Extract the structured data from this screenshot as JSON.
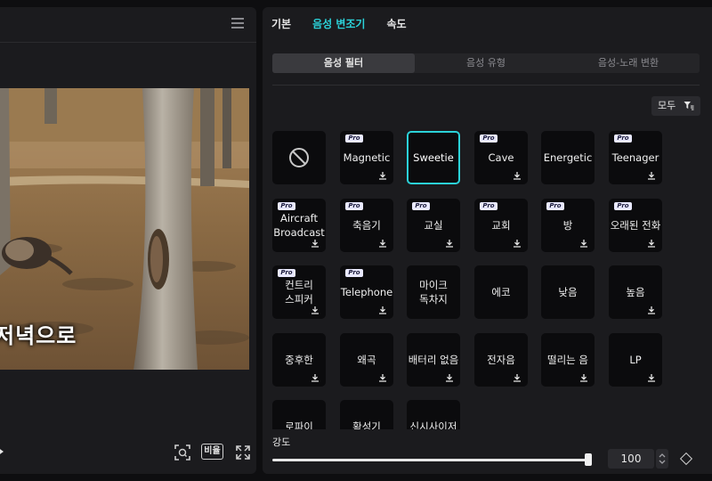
{
  "player": {
    "caption": "저녁으로",
    "ratio_label": "비율"
  },
  "tabs": [
    {
      "label": "기본"
    },
    {
      "label": "음성 변조기"
    },
    {
      "label": "속도"
    }
  ],
  "subtabs": [
    {
      "label": "음성 필터"
    },
    {
      "label": "음성 유형"
    },
    {
      "label": "음성-노래 변환"
    }
  ],
  "filter_button": {
    "label": "모두"
  },
  "pro_badge": "Pro",
  "effects": [
    {
      "label": "",
      "pro": false,
      "download": false,
      "none": true
    },
    {
      "label": "Magnetic",
      "pro": true,
      "download": true
    },
    {
      "label": "Sweetie",
      "pro": false,
      "download": false,
      "selected": true
    },
    {
      "label": "Cave",
      "pro": true,
      "download": true
    },
    {
      "label": "Energetic",
      "pro": false,
      "download": false
    },
    {
      "label": "Teenager",
      "pro": true,
      "download": true
    },
    {
      "label": "Aircraft\nBroadcast",
      "pro": true,
      "download": true
    },
    {
      "label": "축음기",
      "pro": true,
      "download": true
    },
    {
      "label": "교실",
      "pro": true,
      "download": true
    },
    {
      "label": "교회",
      "pro": true,
      "download": true
    },
    {
      "label": "방",
      "pro": true,
      "download": true
    },
    {
      "label": "오래된 전화",
      "pro": true,
      "download": true
    },
    {
      "label": "컨트리\n스피커",
      "pro": true,
      "download": true
    },
    {
      "label": "Telephone",
      "pro": true,
      "download": true
    },
    {
      "label": "마이크\n독차지",
      "pro": false,
      "download": false
    },
    {
      "label": "에코",
      "pro": false,
      "download": false
    },
    {
      "label": "낮음",
      "pro": false,
      "download": false
    },
    {
      "label": "높음",
      "pro": false,
      "download": true
    },
    {
      "label": "중후한",
      "pro": false,
      "download": true
    },
    {
      "label": "왜곡",
      "pro": false,
      "download": true
    },
    {
      "label": "배터리 없음",
      "pro": false,
      "download": true
    },
    {
      "label": "전자음",
      "pro": false,
      "download": true
    },
    {
      "label": "떨리는 음",
      "pro": false,
      "download": true
    },
    {
      "label": "LP",
      "pro": false,
      "download": true
    },
    {
      "label": "로파이",
      "pro": false,
      "download": false
    },
    {
      "label": "확성기",
      "pro": false,
      "download": false
    },
    {
      "label": "신시사이저",
      "pro": false,
      "download": false
    }
  ],
  "intensity": {
    "label": "강도",
    "value": "100",
    "fraction": 1.0
  },
  "colors": {
    "accent": "#2bd2d9",
    "panel": "#1b1b1e",
    "tile": "#0b0b0d"
  }
}
